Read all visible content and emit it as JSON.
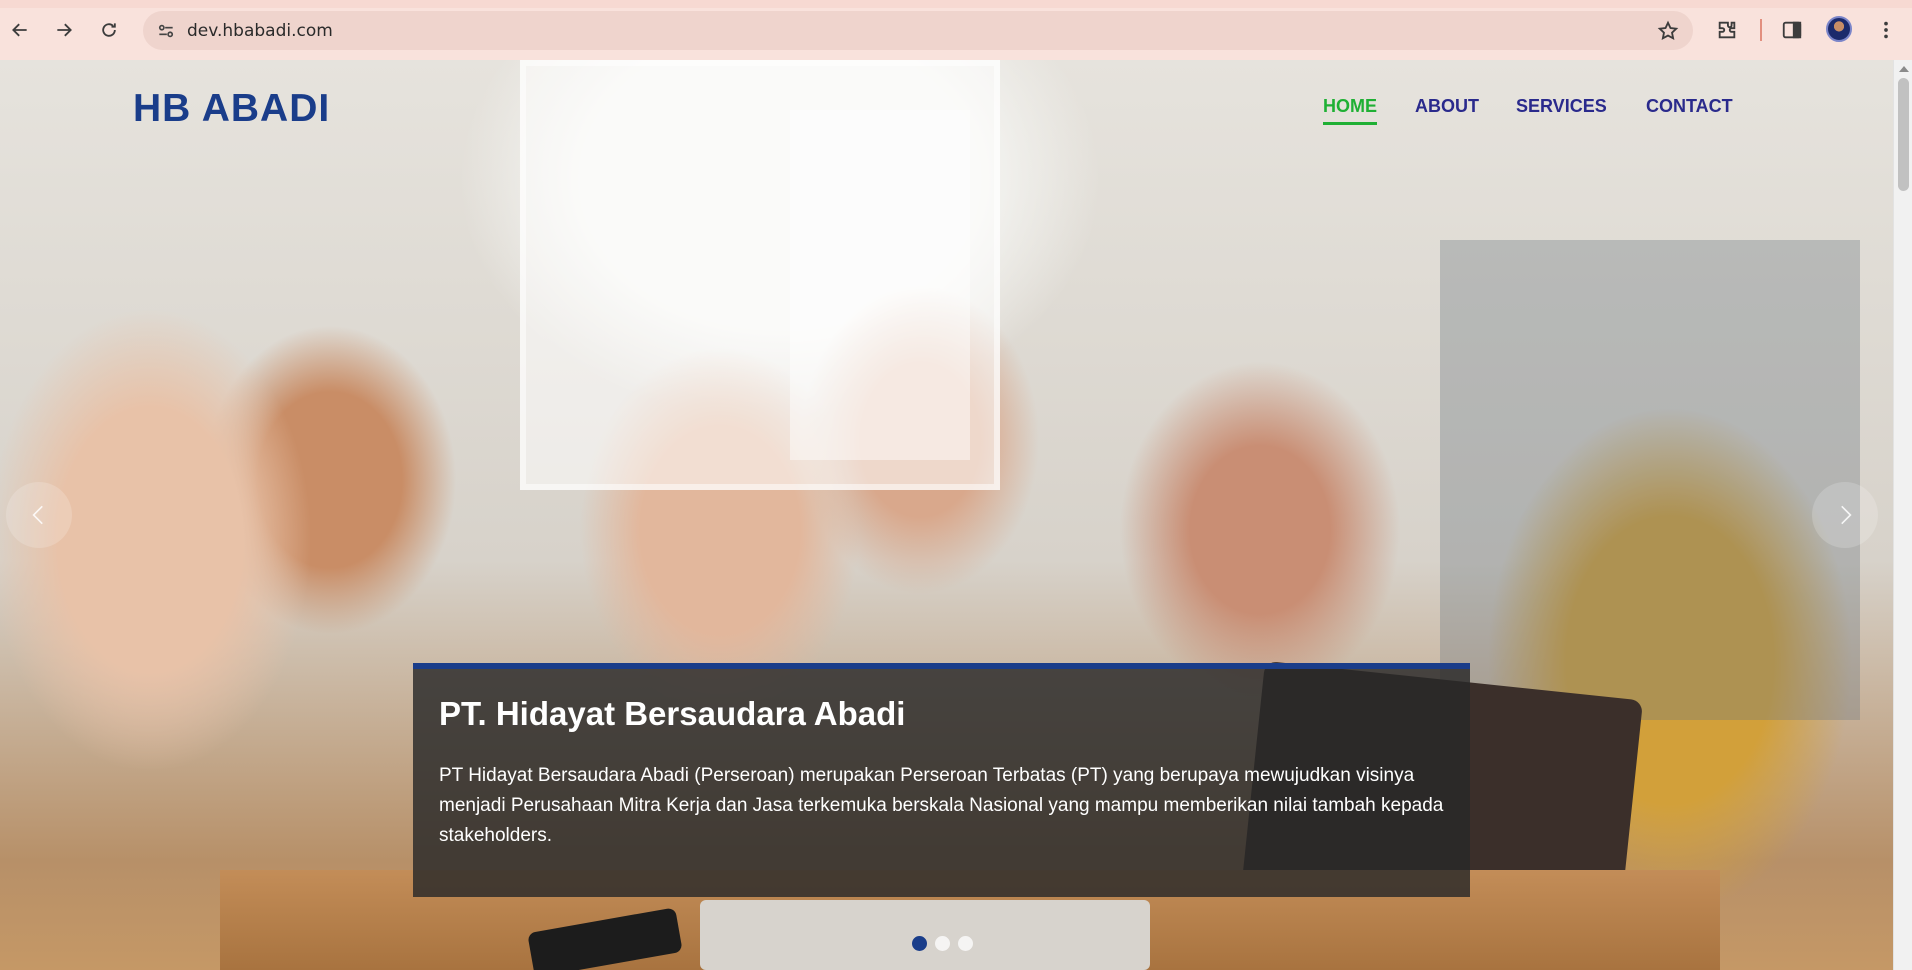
{
  "browser": {
    "url": "dev.hbabadi.com",
    "icons": [
      "back-icon",
      "forward-icon",
      "reload-icon",
      "site-info-icon",
      "bookmark-star-icon",
      "extensions-icon",
      "side-panel-icon",
      "profile-avatar",
      "more-menu-icon"
    ]
  },
  "site": {
    "logo": "HB ABADI",
    "nav": [
      {
        "label": "HOME",
        "active": true
      },
      {
        "label": "ABOUT",
        "active": false
      },
      {
        "label": "SERVICES",
        "active": false
      },
      {
        "label": "CONTACT",
        "active": false
      }
    ],
    "colors": {
      "brand_blue": "#1a3d8a",
      "nav_text": "#2a2a8c",
      "nav_active": "#1fb034"
    }
  },
  "hero": {
    "caption_title": "PT. Hidayat Bersaudara Abadi",
    "caption_text": "PT Hidayat Bersaudara Abadi (Perseroan) merupakan Perseroan Terbatas (PT) yang berupaya mewujudkan visinya menjadi Perusahaan Mitra Kerja dan Jasa terkemuka berskala Nasional yang mampu memberikan nilai tambah kepada stakeholders.",
    "slides_total": 3,
    "active_slide": 1
  }
}
